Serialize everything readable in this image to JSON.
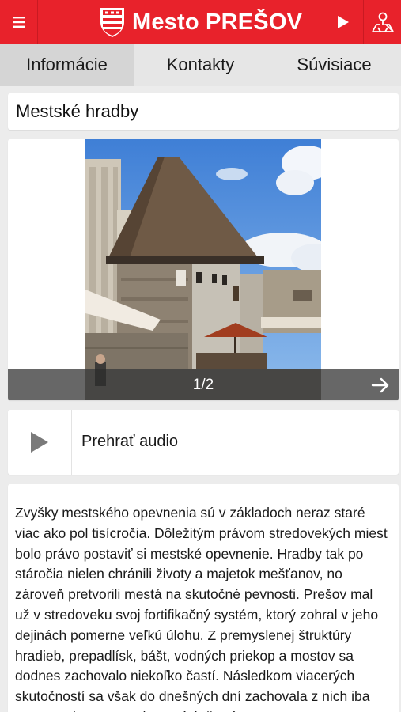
{
  "header": {
    "title": "Mesto PREŠOV",
    "menu_icon": "hamburger-menu-icon",
    "play_icon": "play-icon",
    "map_icon": "map-pin-icon",
    "crest_icon": "city-crest-icon",
    "colors": {
      "brand": "#e8222b",
      "text": "#ffffff"
    }
  },
  "tabs": [
    {
      "label": "Informácie",
      "active": true
    },
    {
      "label": "Kontakty",
      "active": false
    },
    {
      "label": "Súvisiace",
      "active": false
    }
  ],
  "place": {
    "title": "Mestské hradby"
  },
  "gallery": {
    "counter": "1/2",
    "next_icon": "arrow-right-icon"
  },
  "audio": {
    "label": "Prehrať audio",
    "play_icon": "play-icon"
  },
  "description": "Zvyšky mestského opevnenia sú v základoch neraz staré viac ako pol tisícročia. Dôležitým právom stredovekých miest bolo právo postaviť si mestské opevnenie. Hradby tak po stáročia nielen chránili životy a majetok mešťanov, no zároveň pretvorili mestá na skutočné pevnosti. Prešov mal už v stredoveku svoj fortifikačný systém, ktorý zohral v jeho dejinách pomerne veľkú úlohu. Z premyslenej štruktúry hradieb, prepadlísk, bášt, vodných priekop a mostov sa dodnes zachovalo niekoľko častí. Následkom viacerých skutočností sa však do dnešných dní zachovala z nich iba torzo. Jednou zo zachovaných častí"
}
